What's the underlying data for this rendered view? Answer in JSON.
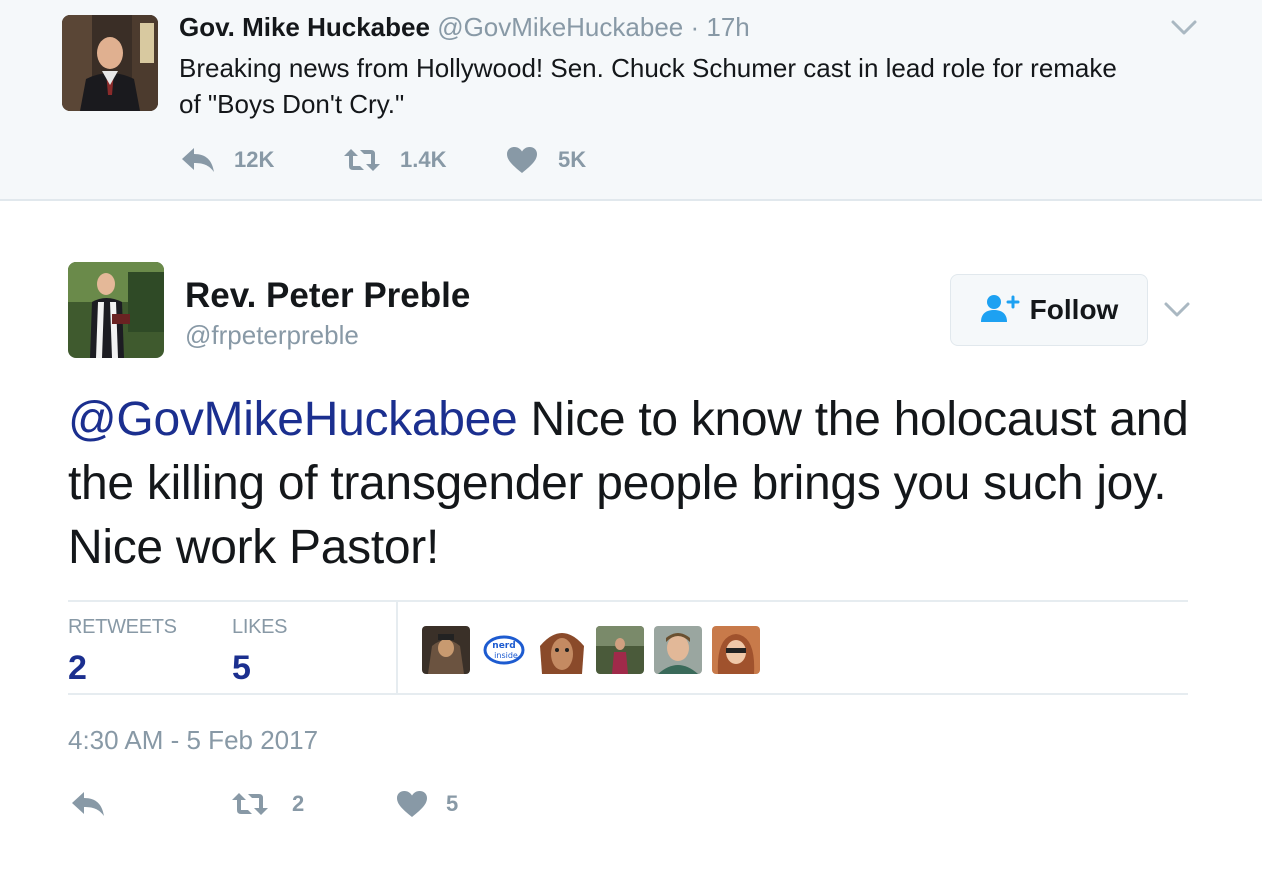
{
  "parent_tweet": {
    "name": "Gov. Mike Huckabee",
    "handle": "@GovMikeHuckabee",
    "separator": "·",
    "time": "17h",
    "text": "Breaking news from Hollywood!  Sen. Chuck Schumer cast in lead role for remake of \"Boys Don't Cry.\"",
    "reply_count": "12K",
    "retweet_count": "1.4K",
    "like_count": "5K"
  },
  "main_tweet": {
    "name": "Rev. Peter Preble",
    "handle": "@frpeterpreble",
    "follow_label": "Follow",
    "mention": "@GovMikeHuckabee",
    "text": " Nice to know the holocaust and the killing of transgender people brings you such joy. Nice work Pastor!",
    "stats": {
      "retweets_label": "RETWEETS",
      "retweets_value": "2",
      "likes_label": "LIKES",
      "likes_value": "5"
    },
    "timestamp": "4:30 AM - 5 Feb 2017",
    "retweet_count": "2",
    "like_count": "5"
  },
  "icons": [
    "reply-icon",
    "retweet-icon",
    "heart-icon",
    "chevron-down-icon",
    "add-user-icon"
  ],
  "colors": {
    "accent": "#1da1f2",
    "mention": "#1b2f8f",
    "muted": "#8899a6",
    "parent_bg": "#f5f8fa"
  }
}
